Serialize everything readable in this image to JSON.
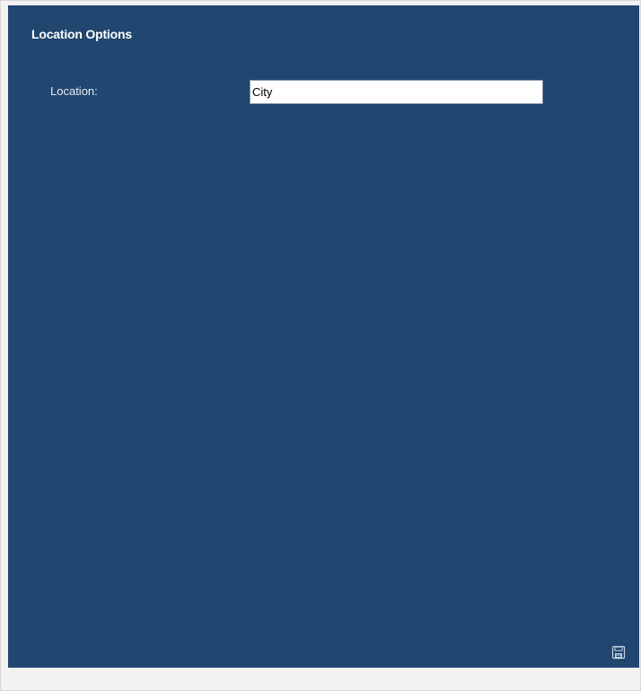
{
  "panel": {
    "title": "Location Options",
    "background_color": "#21466f"
  },
  "location": {
    "label": "Location:",
    "value": "City"
  },
  "toolbar": {
    "save_icon": "floppy-disk-icon"
  }
}
